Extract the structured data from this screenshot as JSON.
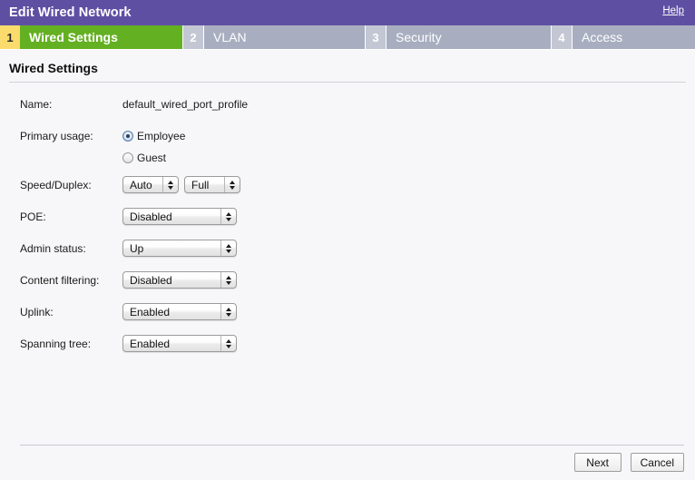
{
  "window": {
    "title": "Edit Wired Network",
    "help_label": "Help"
  },
  "tabs": [
    {
      "number": "1",
      "label": "Wired Settings",
      "active": true
    },
    {
      "number": "2",
      "label": "VLAN",
      "active": false
    },
    {
      "number": "3",
      "label": "Security",
      "active": false
    },
    {
      "number": "4",
      "label": "Access",
      "active": false
    }
  ],
  "section": {
    "heading": "Wired Settings"
  },
  "form": {
    "name": {
      "label": "Name:",
      "value": "default_wired_port_profile"
    },
    "primary_usage": {
      "label": "Primary usage:",
      "options": [
        {
          "label": "Employee",
          "selected": true
        },
        {
          "label": "Guest",
          "selected": false
        }
      ]
    },
    "speed_duplex": {
      "label": "Speed/Duplex:",
      "speed_value": "Auto",
      "duplex_value": "Full"
    },
    "poe": {
      "label": "POE:",
      "value": "Disabled"
    },
    "admin_status": {
      "label": "Admin status:",
      "value": "Up"
    },
    "content_filtering": {
      "label": "Content filtering:",
      "value": "Disabled"
    },
    "uplink": {
      "label": "Uplink:",
      "value": "Enabled"
    },
    "spanning_tree": {
      "label": "Spanning tree:",
      "value": "Enabled"
    }
  },
  "footer": {
    "next_label": "Next",
    "cancel_label": "Cancel"
  },
  "colors": {
    "titlebar": "#5f4fa3",
    "active_tab": "#64b023",
    "active_tab_number": "#fbdb6b",
    "inactive_tab": "#a8aec0",
    "inactive_tab_number": "#c3c7d4",
    "page_background": "#f7f7f9"
  }
}
